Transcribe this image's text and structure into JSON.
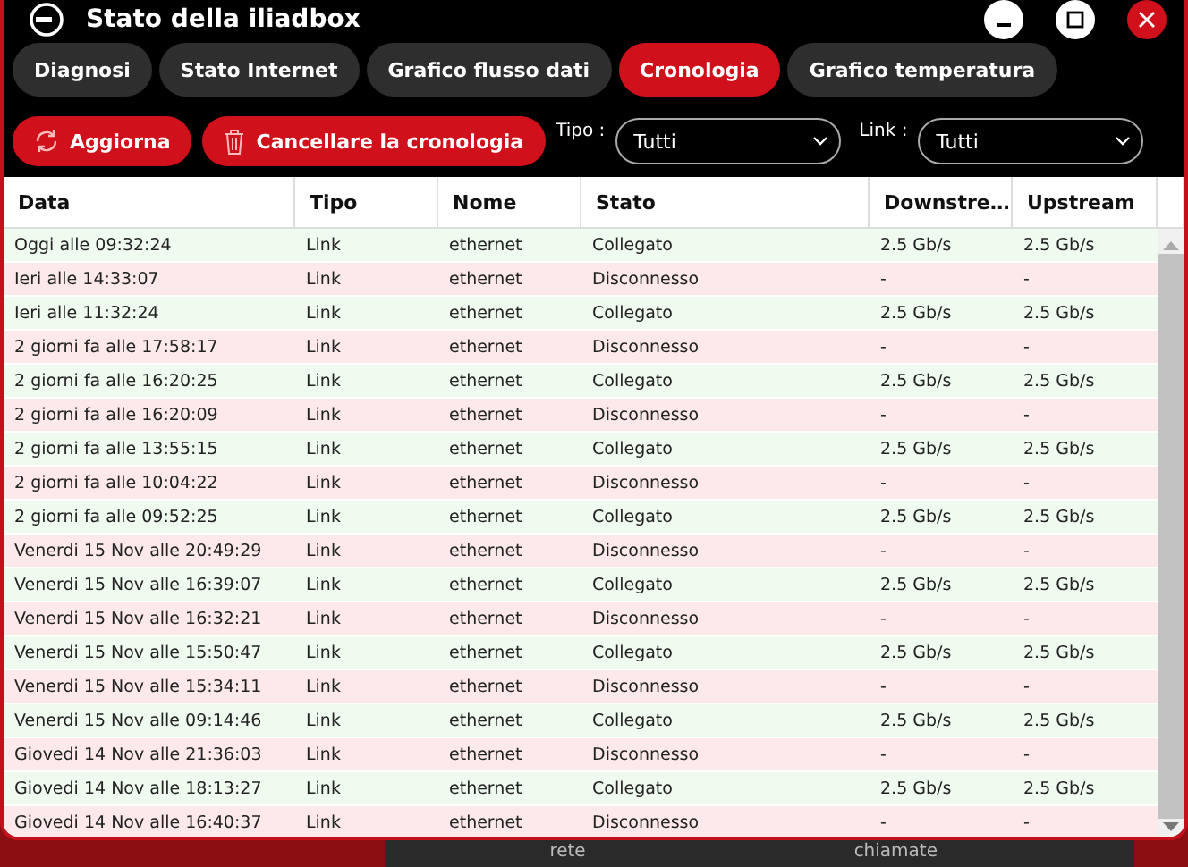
{
  "window": {
    "title": "Stato della iliadbox"
  },
  "tabs": [
    {
      "label": "Diagnosi",
      "selected": false
    },
    {
      "label": "Stato Internet",
      "selected": false
    },
    {
      "label": "Grafico flusso dati",
      "selected": false
    },
    {
      "label": "Cronologia",
      "selected": true
    },
    {
      "label": "Grafico temperatura",
      "selected": false
    }
  ],
  "toolbar": {
    "refresh": "Aggiorna",
    "clear": "Cancellare la cronologia",
    "type_label": "Tipo :",
    "type_value": "Tutti",
    "link_label": "Link :",
    "link_value": "Tutti"
  },
  "table": {
    "columns": [
      "Data",
      "Tipo",
      "Nome",
      "Stato",
      "Downstre…",
      "Upstream"
    ],
    "rows": [
      {
        "kind": "connected",
        "cells": [
          "Oggi alle 09:32:24",
          "Link",
          "ethernet",
          "Collegato",
          "2.5 Gb/s",
          "2.5 Gb/s"
        ]
      },
      {
        "kind": "disconnected",
        "cells": [
          "Ieri alle 14:33:07",
          "Link",
          "ethernet",
          "Disconnesso",
          "-",
          "-"
        ]
      },
      {
        "kind": "connected",
        "cells": [
          "Ieri alle 11:32:24",
          "Link",
          "ethernet",
          "Collegato",
          "2.5 Gb/s",
          "2.5 Gb/s"
        ]
      },
      {
        "kind": "disconnected",
        "cells": [
          "2 giorni fa alle 17:58:17",
          "Link",
          "ethernet",
          "Disconnesso",
          "-",
          "-"
        ]
      },
      {
        "kind": "connected",
        "cells": [
          "2 giorni fa alle 16:20:25",
          "Link",
          "ethernet",
          "Collegato",
          "2.5 Gb/s",
          "2.5 Gb/s"
        ]
      },
      {
        "kind": "disconnected",
        "cells": [
          "2 giorni fa alle 16:20:09",
          "Link",
          "ethernet",
          "Disconnesso",
          "-",
          "-"
        ]
      },
      {
        "kind": "connected",
        "cells": [
          "2 giorni fa alle 13:55:15",
          "Link",
          "ethernet",
          "Collegato",
          "2.5 Gb/s",
          "2.5 Gb/s"
        ]
      },
      {
        "kind": "disconnected",
        "cells": [
          "2 giorni fa alle 10:04:22",
          "Link",
          "ethernet",
          "Disconnesso",
          "-",
          "-"
        ]
      },
      {
        "kind": "connected",
        "cells": [
          "2 giorni fa alle 09:52:25",
          "Link",
          "ethernet",
          "Collegato",
          "2.5 Gb/s",
          "2.5 Gb/s"
        ]
      },
      {
        "kind": "disconnected",
        "cells": [
          "Venerdi 15 Nov alle 20:49:29",
          "Link",
          "ethernet",
          "Disconnesso",
          "-",
          "-"
        ]
      },
      {
        "kind": "connected",
        "cells": [
          "Venerdi 15 Nov alle 16:39:07",
          "Link",
          "ethernet",
          "Collegato",
          "2.5 Gb/s",
          "2.5 Gb/s"
        ]
      },
      {
        "kind": "disconnected",
        "cells": [
          "Venerdi 15 Nov alle 16:32:21",
          "Link",
          "ethernet",
          "Disconnesso",
          "-",
          "-"
        ]
      },
      {
        "kind": "connected",
        "cells": [
          "Venerdi 15 Nov alle 15:50:47",
          "Link",
          "ethernet",
          "Collegato",
          "2.5 Gb/s",
          "2.5 Gb/s"
        ]
      },
      {
        "kind": "disconnected",
        "cells": [
          "Venerdi 15 Nov alle 15:34:11",
          "Link",
          "ethernet",
          "Disconnesso",
          "-",
          "-"
        ]
      },
      {
        "kind": "connected",
        "cells": [
          "Venerdi 15 Nov alle 09:14:46",
          "Link",
          "ethernet",
          "Collegato",
          "2.5 Gb/s",
          "2.5 Gb/s"
        ]
      },
      {
        "kind": "disconnected",
        "cells": [
          "Giovedi 14 Nov alle 21:36:03",
          "Link",
          "ethernet",
          "Disconnesso",
          "-",
          "-"
        ]
      },
      {
        "kind": "connected",
        "cells": [
          "Giovedi 14 Nov alle 18:13:27",
          "Link",
          "ethernet",
          "Collegato",
          "2.5 Gb/s",
          "2.5 Gb/s"
        ]
      },
      {
        "kind": "disconnected",
        "cells": [
          "Giovedi 14 Nov alle 16:40:37",
          "Link",
          "ethernet",
          "Disconnesso",
          "-",
          "-"
        ]
      }
    ]
  },
  "background_labels": [
    "rete",
    "chiamate"
  ]
}
